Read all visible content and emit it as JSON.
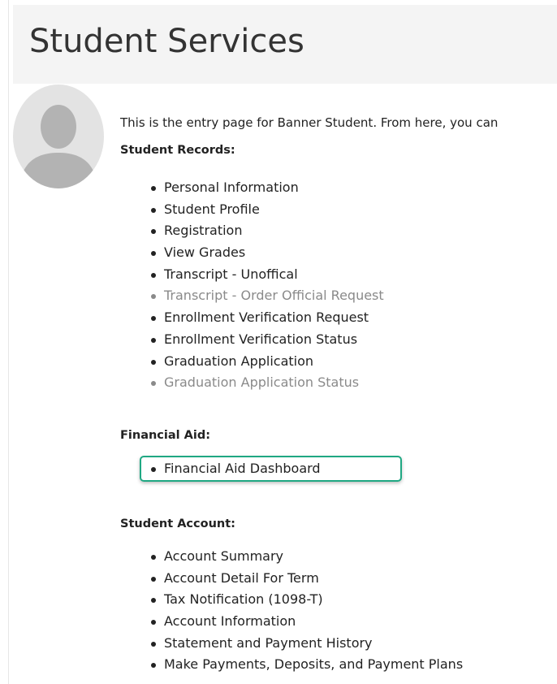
{
  "header": {
    "title": "Student Services"
  },
  "intro_text": "This is the entry page for Banner Student. From here, you can",
  "sections": {
    "student_records": {
      "heading": "Student Records:",
      "items": [
        "Personal Information",
        "Student Profile",
        "Registration",
        "View Grades",
        "Transcript - Unoffical",
        "Transcript - Order Official Request",
        "Enrollment Verification Request",
        "Enrollment Verification Status",
        "Graduation Application",
        "Graduation Application Status"
      ]
    },
    "financial_aid": {
      "heading": "Financial Aid:",
      "items": [
        "Financial Aid Dashboard"
      ]
    },
    "student_account": {
      "heading": "Student Account:",
      "items": [
        "Account Summary",
        "Account Detail For Term",
        "Tax Notification (1098-T)",
        "Account Information",
        "Statement and Payment History",
        "Make Payments, Deposits, and Payment Plans"
      ]
    }
  },
  "colors": {
    "link": "#222222",
    "muted_link": "#8a8a8a",
    "highlight_border": "#1fa883",
    "header_bg": "#f4f4f4"
  },
  "icons": {
    "avatar": "default-user-avatar-icon"
  }
}
